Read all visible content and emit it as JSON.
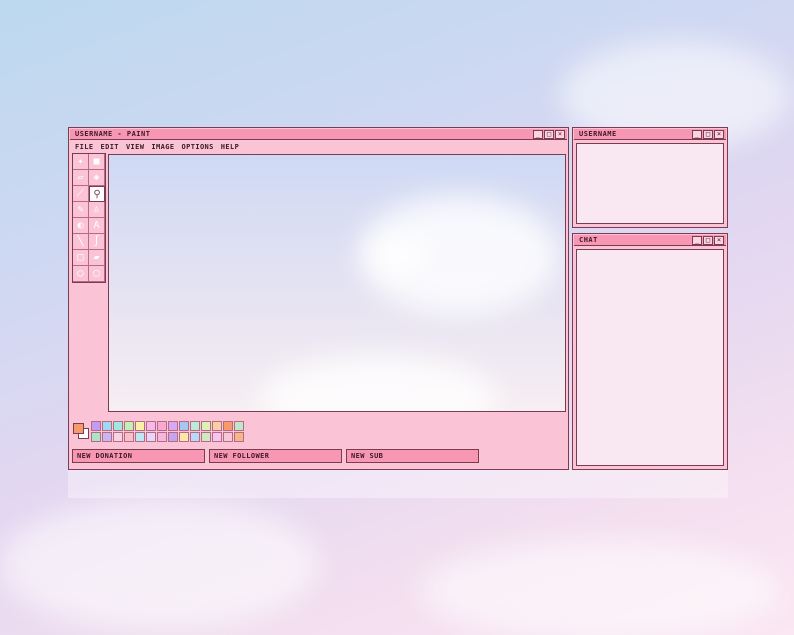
{
  "paint": {
    "title": "USERNAME - PAINT",
    "menu": [
      "FILE",
      "EDIT",
      "VIEW",
      "IMAGE",
      "OPTIONS",
      "HELP"
    ],
    "tools": [
      "select-star-icon",
      "select-rect-icon",
      "eraser-icon",
      "fill-bucket-icon",
      "eyedropper-icon",
      "magnifier-icon",
      "pencil-icon",
      "brush-icon",
      "airbrush-icon",
      "text-icon",
      "line-icon",
      "curve-icon",
      "rectangle-icon",
      "polygon-icon",
      "ellipse-icon",
      "rounded-rect-icon"
    ],
    "selected_tool": "magnifier-icon",
    "foreground_color": "#f79a6b",
    "background_color": "#ffffff",
    "palette": [
      "#c39cf2",
      "#9fd8f4",
      "#9ee8df",
      "#bff0b6",
      "#fbf0a4",
      "#f7b9ea",
      "#f9a9d2",
      "#d6a8f5",
      "#a6c6f6",
      "#b8ecd8",
      "#d9f1b2",
      "#f9d0a5",
      "#f79a6b",
      "#bfe6c8",
      "#a8e4c6",
      "#c6b6f3",
      "#f6d3e3",
      "#f7c2c7",
      "#b9e9f5",
      "#e6d6f7",
      "#f5b7e0",
      "#c7a4f2",
      "#fbe7a6",
      "#b5d9f7",
      "#cfe9c3",
      "#f3c7f0",
      "#f6c7d6",
      "#f7b58a"
    ],
    "status": {
      "donation": "NEW DONATION",
      "follower": "NEW FOLLOWER",
      "sub": "NEW SUB"
    }
  },
  "username_panel": {
    "title": "USERNAME"
  },
  "chat_panel": {
    "title": "CHAT"
  },
  "window_controls": {
    "minimize": "_",
    "maximize": "□",
    "close": "×"
  }
}
